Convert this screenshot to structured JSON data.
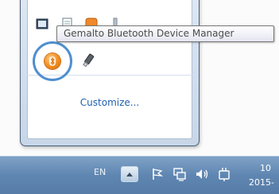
{
  "tooltip": {
    "text": "Gemalto Bluetooth Device Manager"
  },
  "flyout": {
    "customize_label": "Customize..."
  },
  "tray_icons_hidden": [
    {
      "name": "network-monitor-icon"
    },
    {
      "name": "document-icon"
    },
    {
      "name": "orange-app-icon"
    },
    {
      "name": "misc-icon"
    },
    {
      "name": "gemalto-bluetooth-icon"
    },
    {
      "name": "usb-device-icon"
    }
  ],
  "taskbar": {
    "language": "EN",
    "clock_time": "10",
    "clock_date": "2015-"
  },
  "colors": {
    "taskbar": "#5f86b1",
    "highlight_ring": "#4f8fce",
    "link": "#1f5fad",
    "bluetooth_orange": "#f08a1c"
  }
}
